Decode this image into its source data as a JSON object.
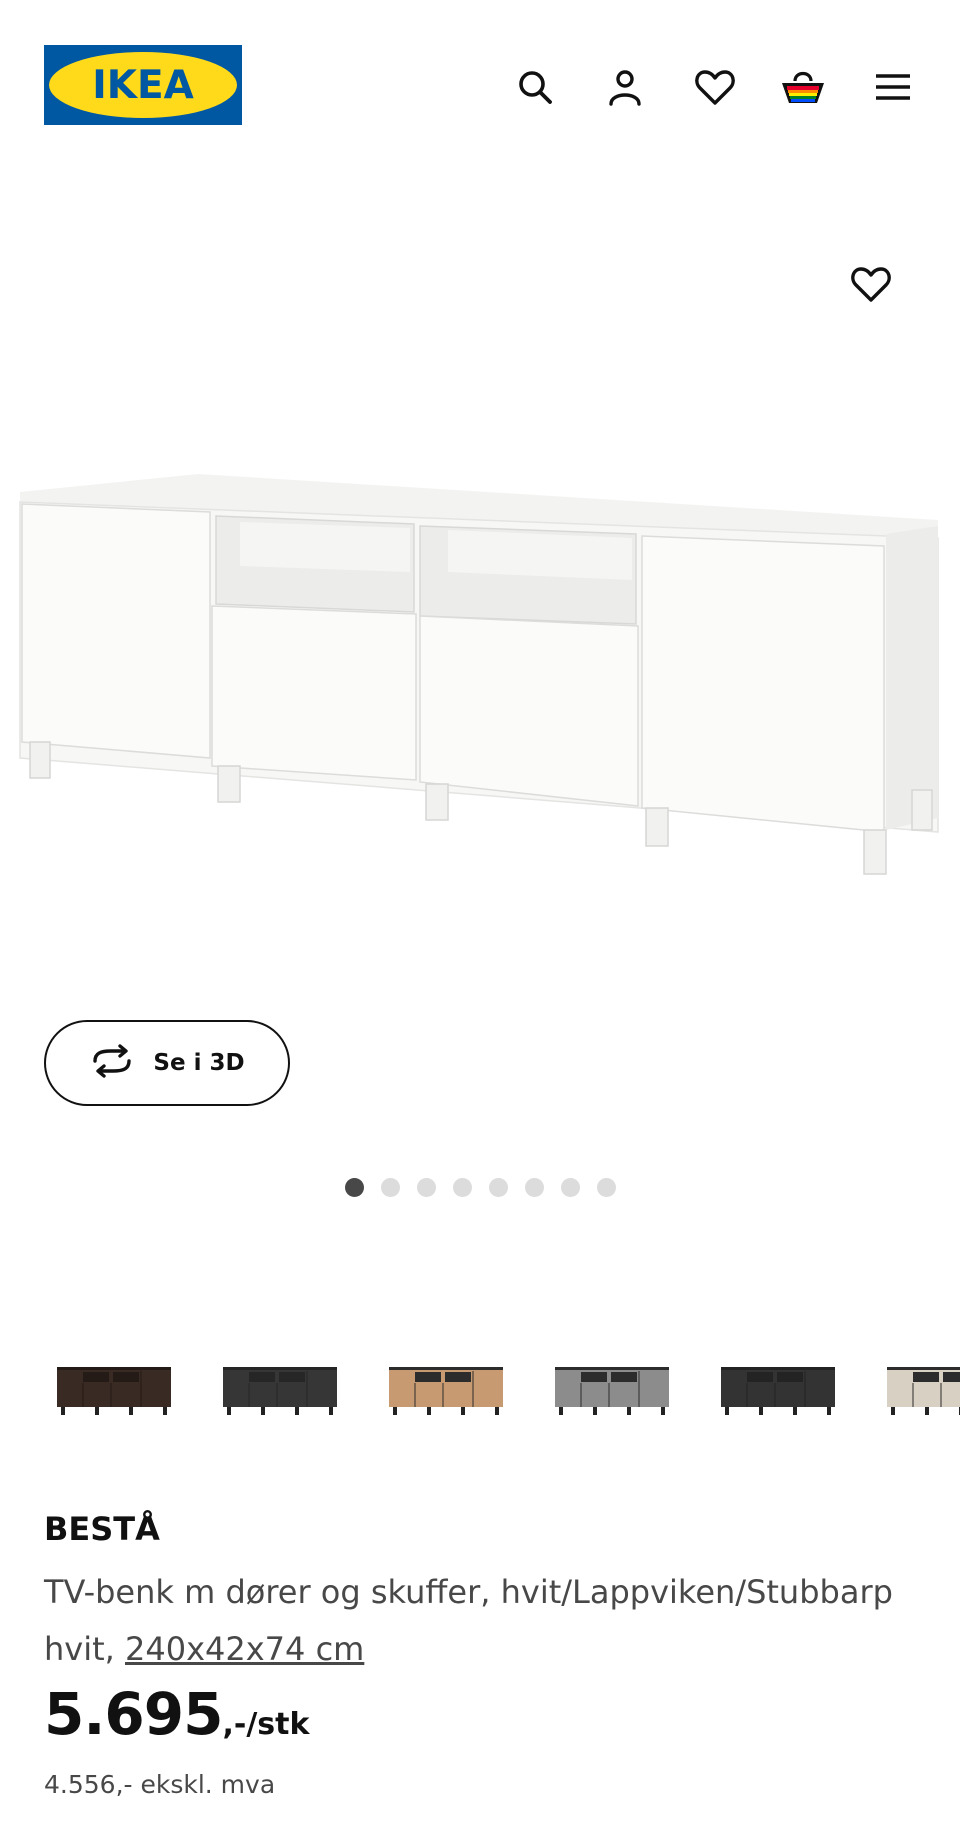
{
  "header": {
    "logo_text": "IKEA",
    "icons": [
      "search-icon",
      "user-icon",
      "heart-icon",
      "basket-icon",
      "menu-icon"
    ]
  },
  "product": {
    "favourite_icon": "heart-icon",
    "view_3d_label": "Se i 3D",
    "gallery": {
      "total": 8,
      "active": 1
    },
    "variants": [
      {
        "colors": [
          "#3a2a24",
          "#241a16"
        ]
      },
      {
        "colors": [
          "#363636",
          "#262626"
        ]
      },
      {
        "colors": [
          "#c79a72",
          "#2c2c2c"
        ]
      },
      {
        "colors": [
          "#8c8c8c",
          "#2c2c2c"
        ]
      },
      {
        "colors": [
          "#333333",
          "#232323"
        ]
      },
      {
        "colors": [
          "#d8d0c2",
          "#2c2c2c"
        ]
      }
    ],
    "name": "BESTÅ",
    "description": "TV-benk m dører og skuffer, hvit/Lappviken/Stubbarp hvit,",
    "dimensions": "240x42x74 cm",
    "price": "5.695",
    "price_suffix": ",-/stk",
    "price_excl_vat": "4.556,- ekskl. mva"
  },
  "colors": {
    "ikea_blue": "#0058a3",
    "ikea_yellow": "#ffda1a",
    "text": "#111111",
    "text_secondary": "#484848",
    "dot_inactive": "#dcdcdc",
    "dot_active": "#484848"
  }
}
